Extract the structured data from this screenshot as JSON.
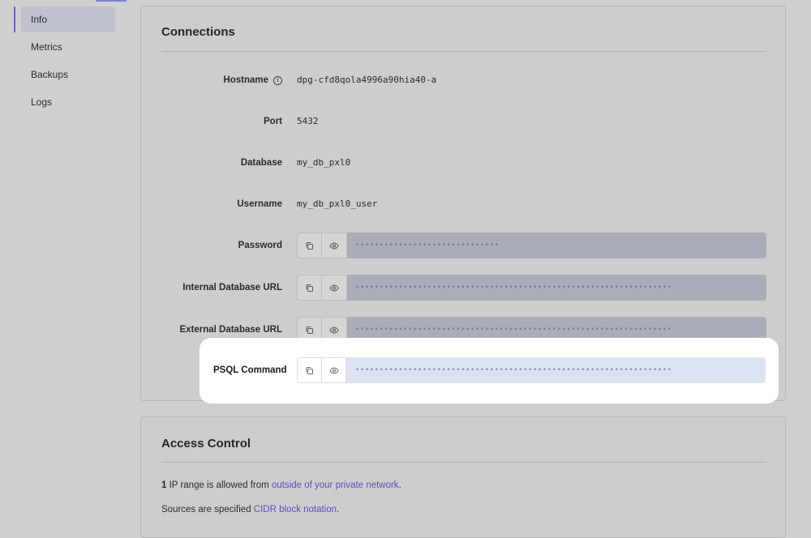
{
  "sidebar": {
    "items": [
      {
        "label": "Info",
        "active": true
      },
      {
        "label": "Metrics",
        "active": false
      },
      {
        "label": "Backups",
        "active": false
      },
      {
        "label": "Logs",
        "active": false
      }
    ]
  },
  "connections": {
    "title": "Connections",
    "hostname": {
      "label": "Hostname",
      "value": "dpg-cfd8qola4996a90hia40-a",
      "icon": "info-icon"
    },
    "port": {
      "label": "Port",
      "value": "5432"
    },
    "database": {
      "label": "Database",
      "value": "my_db_pxl0"
    },
    "username": {
      "label": "Username",
      "value": "my_db_pxl0_user"
    },
    "password": {
      "label": "Password",
      "masked": "••••••••••••••••••••••••••••••"
    },
    "internal_url": {
      "label": "Internal Database URL",
      "masked": "••••••••••••••••••••••••••••••••••••••••••••••••••••••••••••••••••"
    },
    "external_url": {
      "label": "External Database URL",
      "masked": "••••••••••••••••••••••••••••••••••••••••••••••••••••••••••••••••••"
    },
    "psql_command": {
      "label": "PSQL Command",
      "masked": "••••••••••••••••••••••••••••••••••••••••••••••••••••••••••••••••••"
    },
    "icons": {
      "copy": "copy-icon",
      "reveal": "eye-icon"
    }
  },
  "access_control": {
    "title": "Access Control",
    "line1": {
      "count": "1",
      "text": " IP range is allowed from ",
      "link": "outside of your private network",
      "end": "."
    },
    "line2": {
      "text": "Sources are specified ",
      "link": "CIDR block notation",
      "end": "."
    }
  },
  "colors": {
    "accent": "#5b4fc4",
    "highlight_field": "#dde2f3",
    "dimmed_field": "#a9aeb9"
  }
}
